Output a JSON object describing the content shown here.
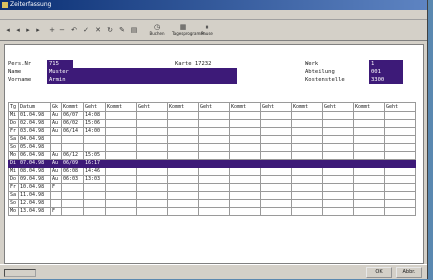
{
  "window": {
    "title": "Zeiterfassung"
  },
  "toolbar": {
    "icons": [
      "first-icon",
      "prev-icon",
      "next-icon",
      "last-icon",
      "add-icon",
      "delete-icon",
      "undo-icon",
      "save-icon",
      "cancel-icon",
      "refresh-icon",
      "edit-icon",
      "print-icon"
    ],
    "buttons": [
      {
        "label": "Buchen"
      },
      {
        "label": "Tagesprogramm"
      },
      {
        "label": "Pause"
      }
    ]
  },
  "header": {
    "pers_nr_label": "Pers.Nr",
    "pers_nr_value": "715",
    "karte_label": "Karte 17232",
    "name_label": "Name",
    "name_value": "Muster",
    "vorname_label": "Vorname",
    "vorname_value": "Armin",
    "werk_label": "Werk",
    "werk_value": "1",
    "abteilung_label": "Abteilung",
    "abteilung_value": "001",
    "kostenstelle_label": "Kostenstelle",
    "kostenstelle_value": "3300"
  },
  "grid": {
    "columns": [
      "Tg",
      "Datum",
      "Gk",
      "Kommt",
      "Geht",
      "Kommt",
      "Geht",
      "Kommt",
      "Geht",
      "Kommt",
      "Geht",
      "Kommt",
      "Geht",
      "Kommt",
      "Geht"
    ],
    "rows": [
      [
        "Mi",
        "01.04.98",
        "Au",
        "06/07",
        "14:08"
      ],
      [
        "Do",
        "02.04.98",
        "Au",
        "06/02",
        "15:06"
      ],
      [
        "Fr",
        "03.04.98",
        "Au",
        "06/14",
        "14:00"
      ],
      [
        "Sa",
        "04.04.98",
        "",
        "",
        ""
      ],
      [
        "So",
        "05.04.98",
        "",
        "",
        ""
      ],
      [
        "Mo",
        "06.04.98",
        "Au",
        "06/12",
        "15:05"
      ],
      [
        "Di",
        "07.04.98",
        "Au",
        "06/09",
        "16:17"
      ],
      [
        "Mi",
        "08.04.98",
        "Au",
        "06:08",
        "14:46"
      ],
      [
        "Do",
        "09.04.98",
        "Au",
        "06:03",
        "13:03"
      ],
      [
        "Fr",
        "10.04.98",
        "F",
        "",
        ""
      ],
      [
        "Sa",
        "11.04.98",
        "",
        "",
        ""
      ],
      [
        "So",
        "12.04.98",
        "",
        "",
        ""
      ],
      [
        "Mo",
        "13.04.98",
        "F",
        "",
        ""
      ]
    ],
    "selected_row": 6
  },
  "statusbar": {
    "ok_label": "OK",
    "cancel_label": "Abbr."
  }
}
